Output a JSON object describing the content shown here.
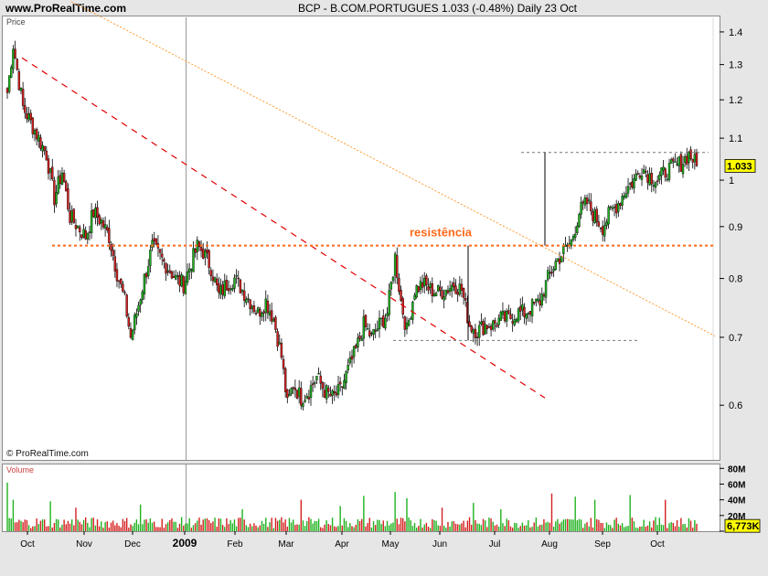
{
  "header": {
    "site": "www.ProRealTime.com",
    "title": "BCP - B.COM.PORTUGUES     1.033 (-0.48%)    Daily  23 Oct"
  },
  "price_panel": {
    "label": "Price",
    "copyright": "© ProRealTime.com"
  },
  "volume_panel": {
    "label": "Volume"
  },
  "colors": {
    "up": "#1fb21f",
    "down": "#d42020",
    "resistance": "#ff6a1a",
    "trend": "#ff9a30",
    "downtrend": "#e00000",
    "grid": "#bbbbbb"
  },
  "chart_data": [
    {
      "type": "candlestick",
      "y_scale": "log",
      "ylim": [
        0.53,
        1.45
      ],
      "y_ticks": [
        0.6,
        0.7,
        0.8,
        0.9,
        1,
        1.1,
        1.2,
        1.3,
        1.4
      ],
      "y_tick_labels": [
        "0.6",
        "0.7",
        "0.8",
        "0.9",
        "1",
        "1.1",
        "1.2",
        "1.3",
        "1.4"
      ],
      "x_labels": [
        "Oct",
        "Nov",
        "Dec",
        "2009",
        "Feb",
        "Mar",
        "Apr",
        "May",
        "Jun",
        "Jul",
        "Aug",
        "Sep",
        "Oct"
      ],
      "last_price": 1.033,
      "last_price_label": "1.033",
      "resistance": {
        "level": 0.862,
        "label": "resistência"
      },
      "close_path": [
        [
          0,
          1.22
        ],
        [
          3,
          1.36
        ],
        [
          8,
          1.18
        ],
        [
          14,
          1.12
        ],
        [
          20,
          1.06
        ],
        [
          24,
          0.96
        ],
        [
          28,
          1.02
        ],
        [
          32,
          0.92
        ],
        [
          36,
          0.9
        ],
        [
          40,
          0.88
        ],
        [
          44,
          0.93
        ],
        [
          48,
          0.91
        ],
        [
          52,
          0.88
        ],
        [
          56,
          0.81
        ],
        [
          60,
          0.76
        ],
        [
          63,
          0.7
        ],
        [
          66,
          0.74
        ],
        [
          70,
          0.8
        ],
        [
          74,
          0.86
        ],
        [
          78,
          0.84
        ],
        [
          82,
          0.82
        ],
        [
          86,
          0.8
        ],
        [
          90,
          0.79
        ],
        [
          94,
          0.83
        ],
        [
          97,
          0.86
        ],
        [
          100,
          0.85
        ],
        [
          104,
          0.82
        ],
        [
          108,
          0.77
        ],
        [
          112,
          0.79
        ],
        [
          116,
          0.8
        ],
        [
          120,
          0.78
        ],
        [
          124,
          0.76
        ],
        [
          128,
          0.74
        ],
        [
          132,
          0.76
        ],
        [
          136,
          0.73
        ],
        [
          140,
          0.67
        ],
        [
          143,
          0.6
        ],
        [
          146,
          0.63
        ],
        [
          150,
          0.61
        ],
        [
          154,
          0.62
        ],
        [
          158,
          0.64
        ],
        [
          162,
          0.62
        ],
        [
          166,
          0.61
        ],
        [
          170,
          0.62
        ],
        [
          174,
          0.65
        ],
        [
          178,
          0.68
        ],
        [
          182,
          0.72
        ],
        [
          186,
          0.7
        ],
        [
          190,
          0.72
        ],
        [
          194,
          0.74
        ],
        [
          198,
          0.84
        ],
        [
          201,
          0.76
        ],
        [
          204,
          0.71
        ],
        [
          208,
          0.78
        ],
        [
          212,
          0.79
        ],
        [
          216,
          0.78
        ],
        [
          220,
          0.775
        ],
        [
          224,
          0.78
        ],
        [
          228,
          0.79
        ],
        [
          232,
          0.78
        ],
        [
          236,
          0.72
        ],
        [
          240,
          0.71
        ],
        [
          244,
          0.72
        ],
        [
          248,
          0.72
        ],
        [
          252,
          0.73
        ],
        [
          256,
          0.73
        ],
        [
          260,
          0.74
        ],
        [
          264,
          0.74
        ],
        [
          268,
          0.75
        ],
        [
          272,
          0.76
        ],
        [
          276,
          0.8
        ],
        [
          280,
          0.83
        ],
        [
          284,
          0.85
        ],
        [
          288,
          0.87
        ],
        [
          292,
          0.93
        ],
        [
          296,
          0.95
        ],
        [
          300,
          0.92
        ],
        [
          304,
          0.9
        ],
        [
          308,
          0.93
        ],
        [
          312,
          0.95
        ],
        [
          316,
          0.98
        ],
        [
          320,
          1.0
        ],
        [
          324,
          1.03
        ],
        [
          328,
          1.01
        ],
        [
          332,
          1.0
        ],
        [
          336,
          1.02
        ],
        [
          340,
          1.03
        ],
        [
          344,
          1.04
        ],
        [
          348,
          1.06
        ],
        [
          350,
          1.05
        ],
        [
          352,
          1.033
        ]
      ]
    },
    {
      "type": "bar",
      "title": "Volume",
      "y_ticks": [
        0,
        20000000,
        40000000,
        60000000,
        80000000
      ],
      "y_tick_labels": [
        "",
        "20M",
        "40M",
        "60M",
        "80M"
      ],
      "ylim": [
        0,
        85000000
      ],
      "last_value_label": "6,773K",
      "spike_days": [
        0,
        3,
        22,
        35,
        68,
        120,
        150,
        170,
        182,
        198,
        204,
        222,
        238,
        252,
        278,
        290,
        300,
        318,
        336
      ],
      "spike_values": [
        62000000,
        40000000,
        38000000,
        30000000,
        34000000,
        28000000,
        40000000,
        32000000,
        45000000,
        50000000,
        42000000,
        30000000,
        36000000,
        28000000,
        48000000,
        44000000,
        40000000,
        46000000,
        40000000
      ]
    }
  ]
}
